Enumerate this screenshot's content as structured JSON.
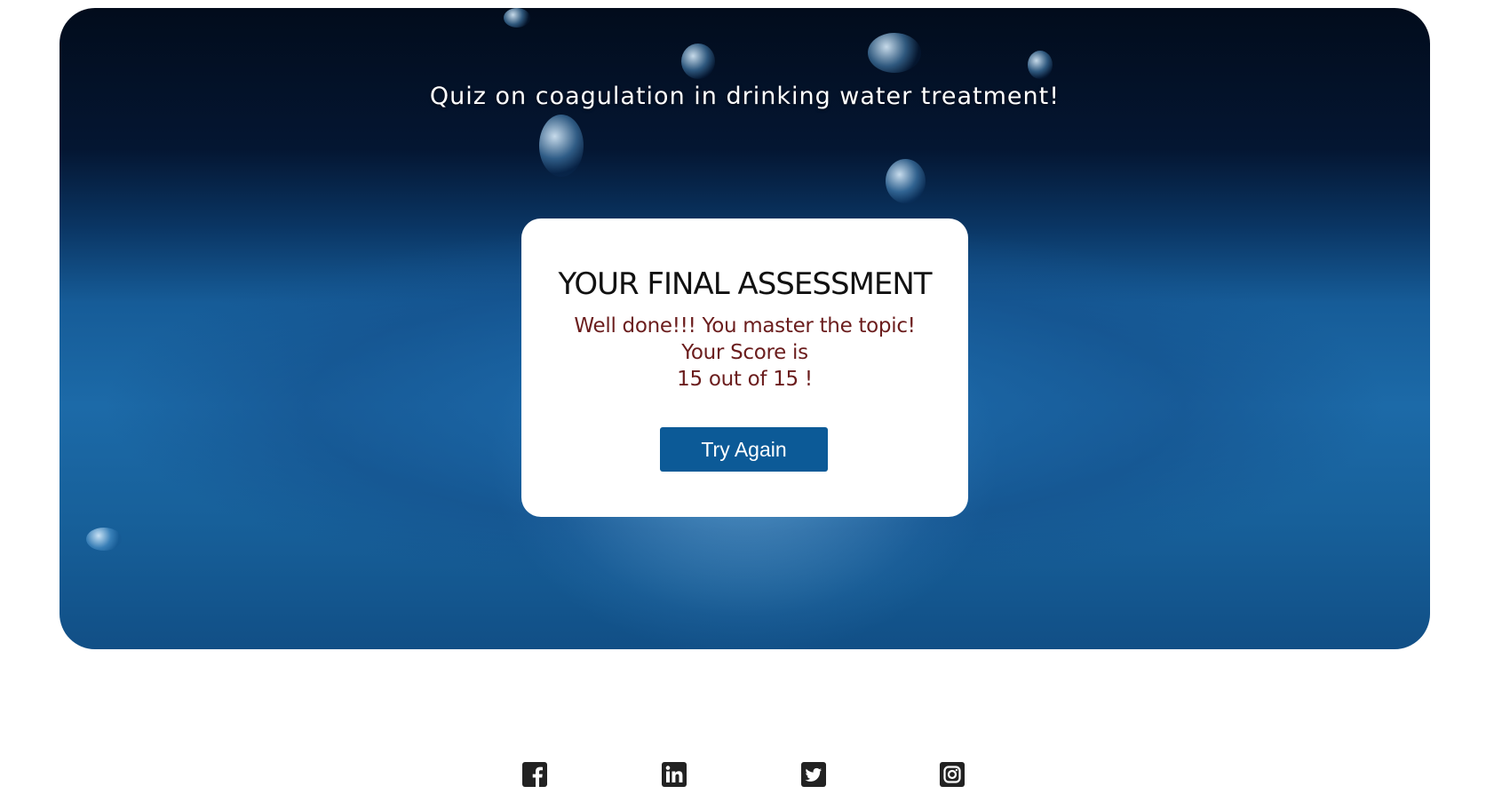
{
  "hero": {
    "title": "Quiz on coagulation in drinking water treatment!"
  },
  "result": {
    "heading": "YOUR FINAL ASSESSMENT",
    "message": "Well done!!! You master the topic!",
    "score_label": "Your Score is",
    "score_text": "15 out of 15 !",
    "score": 15,
    "total": 15,
    "button_label": "Try Again"
  },
  "footer": {
    "social_icons": [
      "facebook-icon",
      "linkedin-icon",
      "twitter-icon",
      "instagram-icon"
    ]
  },
  "colors": {
    "button": "#0c5a97",
    "message_text": "#6b1d1d",
    "icon": "#222222"
  }
}
